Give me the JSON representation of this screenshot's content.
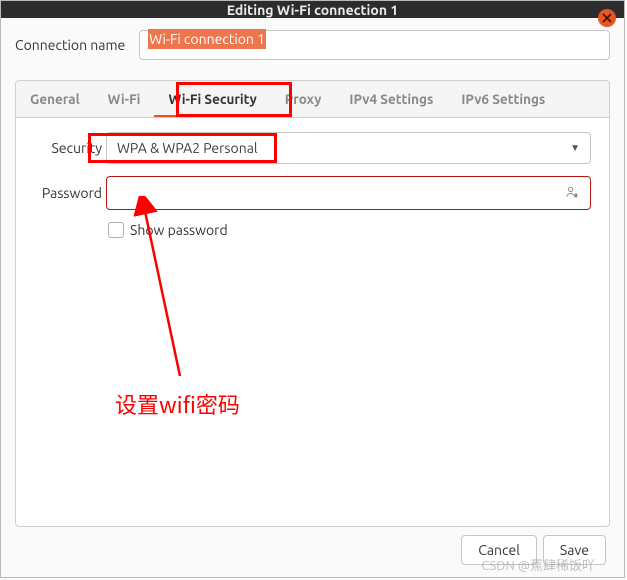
{
  "window": {
    "title": "Editing Wi-Fi connection 1"
  },
  "name_row": {
    "label": "Connection name",
    "value": "Wi-Fi connection 1"
  },
  "tabs": {
    "general": "General",
    "wifi": "Wi-Fi",
    "security": "Wi-Fi Security",
    "proxy": "Proxy",
    "ipv4": "IPv4 Settings",
    "ipv6": "IPv6 Settings"
  },
  "form": {
    "security_label": "Security",
    "security_value": "WPA & WPA2 Personal",
    "password_label": "Password",
    "password_value": "",
    "show_password": "Show password"
  },
  "footer": {
    "cancel": "Cancel",
    "save": "Save"
  },
  "annotation": {
    "text": "设置wifi密码"
  },
  "watermark": "CSDN @蕉肆稀饭吖"
}
